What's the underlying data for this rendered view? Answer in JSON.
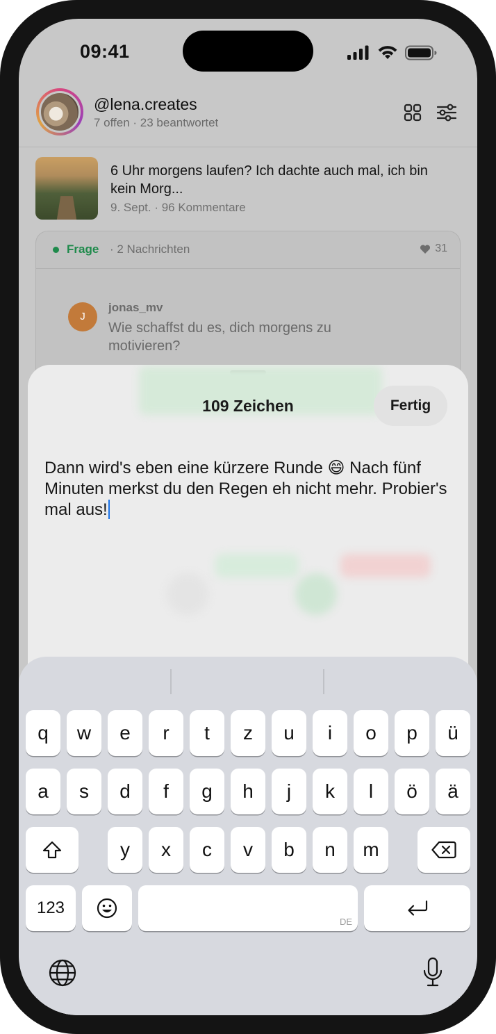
{
  "status_bar": {
    "time": "09:41"
  },
  "header": {
    "username": "@lena.creates",
    "subline": "7 offen · 23 beantwortet",
    "icons": [
      "grid-icon",
      "filter-sliders-icon"
    ]
  },
  "post": {
    "title": "6 Uhr morgens laufen? Ich dachte auch mal, ich bin kein Morg...",
    "meta": "9. Sept. · 96 Kommentare"
  },
  "question_card": {
    "tag": "Frage",
    "messages": "· 2 Nachrichten",
    "likes": "31",
    "message": {
      "avatar_initial": "J",
      "user": "jonas_mv",
      "text": "Wie schaffst du es, dich morgens zu motivieren?"
    }
  },
  "composer": {
    "char_count": "109 Zeichen",
    "done_label": "Fertig",
    "text": "Dann wird's eben eine kürzere Runde 😄 Nach fünf Minuten merkst du den Regen eh nicht mehr. Probier's mal aus!"
  },
  "keyboard": {
    "row1": [
      "q",
      "w",
      "e",
      "r",
      "t",
      "z",
      "u",
      "i",
      "o",
      "p",
      "ü"
    ],
    "row2": [
      "a",
      "s",
      "d",
      "f",
      "g",
      "h",
      "j",
      "k",
      "l",
      "ö",
      "ä"
    ],
    "row3": [
      "y",
      "x",
      "c",
      "v",
      "b",
      "n",
      "m"
    ],
    "numbers_label": "123",
    "space_lang": "DE"
  }
}
